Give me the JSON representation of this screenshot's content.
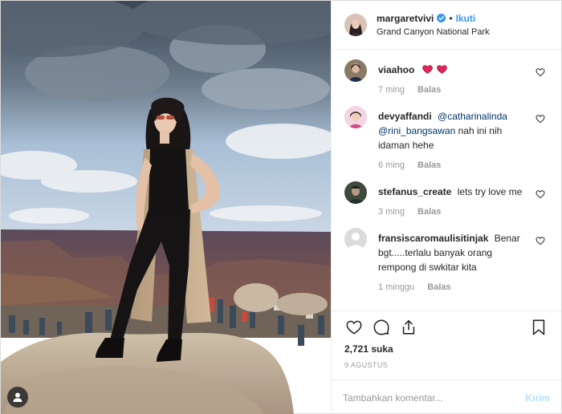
{
  "header": {
    "username": "margaretvivi",
    "separator": "•",
    "follow_label": "Ikuti",
    "location": "Grand Canyon National Park",
    "icons": {
      "verified": "verified-badge-icon"
    }
  },
  "comments": [
    {
      "user": "viaahoo",
      "text": "",
      "emoji": "two-red-hearts",
      "time": "7 ming",
      "reply_label": "Balas"
    },
    {
      "user": "devyaffandi",
      "mention_1": "@catharinalinda",
      "mention_2": "@rini_bangsawan",
      "text": "nah ini nih idaman hehe",
      "time": "6 ming",
      "reply_label": "Balas"
    },
    {
      "user": "stefanus_create",
      "text": "lets try love me",
      "time": "3 ming",
      "reply_label": "Balas"
    },
    {
      "user": "fransiscaromaulisitinjak",
      "text": "Benar bgt.....terlalu banyak orang rempong di swkitar kita",
      "time": "1 minggu",
      "reply_label": "Balas"
    }
  ],
  "actions": {
    "likes": "2,721 suka",
    "date": "9 AGUSTUS",
    "icons": [
      "heart-icon",
      "comment-icon",
      "share-icon",
      "bookmark-icon"
    ]
  },
  "add_comment": {
    "placeholder": "Tambahkan komentar...",
    "post_label": "Kirim"
  },
  "colors": {
    "link_blue": "#3897f0",
    "mention_blue": "#003569",
    "muted": "#999999",
    "post_disabled": "#b2dffc",
    "border": "#efefef"
  }
}
